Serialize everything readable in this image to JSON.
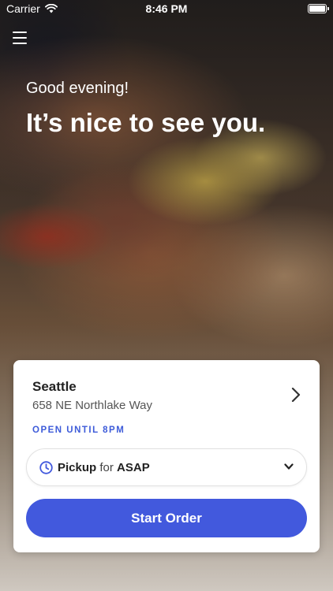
{
  "status_bar": {
    "carrier": "Carrier",
    "time": "8:46 PM",
    "icons": [
      "wifi-icon",
      "battery-icon"
    ]
  },
  "header": {
    "menu_icon": "hamburger-menu-icon"
  },
  "hero": {
    "greeting": "Good evening!",
    "headline": "It’s nice to see you."
  },
  "location_card": {
    "name": "Seattle",
    "address": "658 NE Northlake Way",
    "status": "OPEN UNTIL 8PM",
    "pickup": {
      "mode": "Pickup",
      "connector": "for",
      "time": "ASAP"
    },
    "start_button": "Start Order"
  },
  "colors": {
    "accent": "#4259dd",
    "status_text": "#3d5bd9"
  }
}
